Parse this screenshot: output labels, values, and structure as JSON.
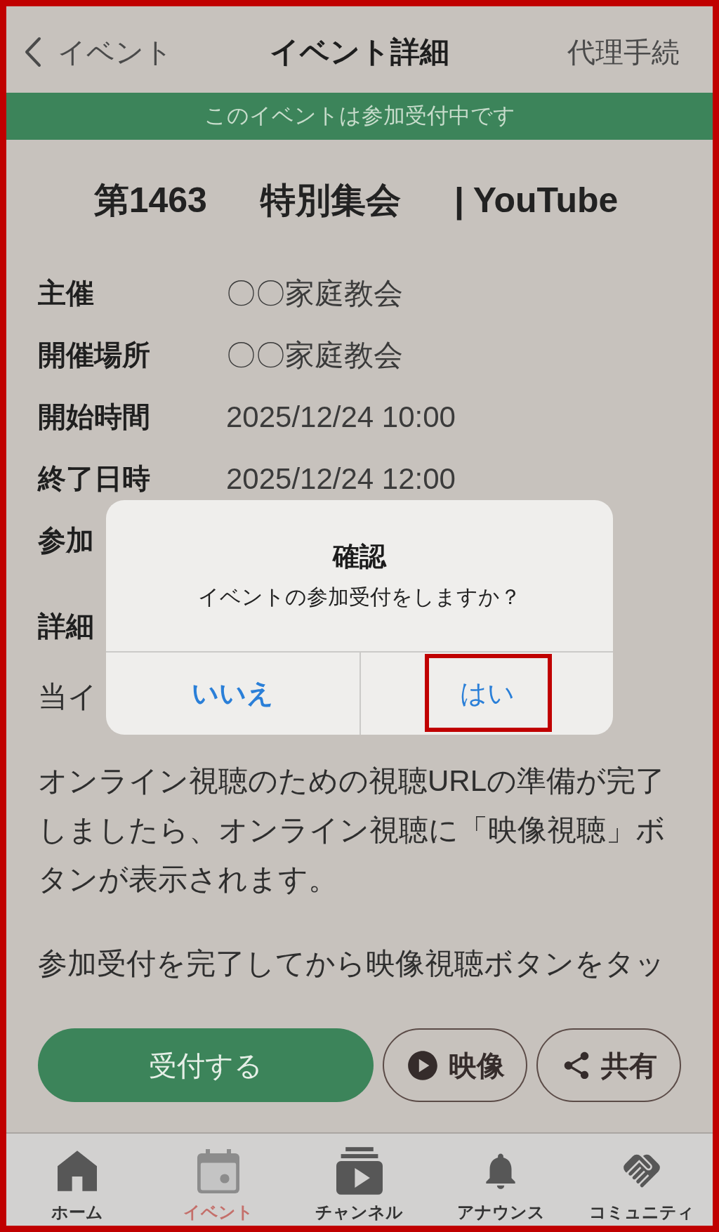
{
  "header": {
    "back_label": "イベント",
    "title": "イベント詳細",
    "action": "代理手続"
  },
  "status_banner": "このイベントは参加受付中です",
  "event": {
    "title_parts": [
      "第1463",
      "特別集会",
      "| YouTube"
    ],
    "details": [
      {
        "label": "主催",
        "value": "〇〇家庭教会"
      },
      {
        "label": "開催場所",
        "value": "〇〇家庭教会"
      },
      {
        "label": "開始時間",
        "value": "2025/12/24 10:00"
      },
      {
        "label": "終了日時",
        "value": "2025/12/24 12:00"
      },
      {
        "label": "参加"
      }
    ],
    "description": {
      "heading": "詳細",
      "paragraphs": [
        "当イ",
        "オンライン視聴のための視聴URLの準備が完了しましたら、オンライン視聴に「映像視聴」ボタンが表示されます。",
        "参加受付を完了してから映像視聴ボタンをタッ"
      ]
    }
  },
  "actions": [
    {
      "kind": "filled",
      "label": "受付する"
    },
    {
      "kind": "outlined",
      "label": "映像"
    },
    {
      "kind": "outlined",
      "label": "共有"
    }
  ],
  "dialog": {
    "title": "確認",
    "message": "イベントの参加受付をしますか？",
    "buttons": [
      {
        "label": "いいえ",
        "emphasized": true,
        "highlighted": false
      },
      {
        "label": "はい",
        "emphasized": false,
        "highlighted": true
      }
    ]
  },
  "tab_bar": [
    {
      "label": "ホーム",
      "selected": false
    },
    {
      "label": "イベント",
      "selected": true
    },
    {
      "label": "チャンネル",
      "selected": false
    },
    {
      "label": "アナウンス",
      "selected": false
    },
    {
      "label": "コミュニティ",
      "selected": false
    }
  ]
}
